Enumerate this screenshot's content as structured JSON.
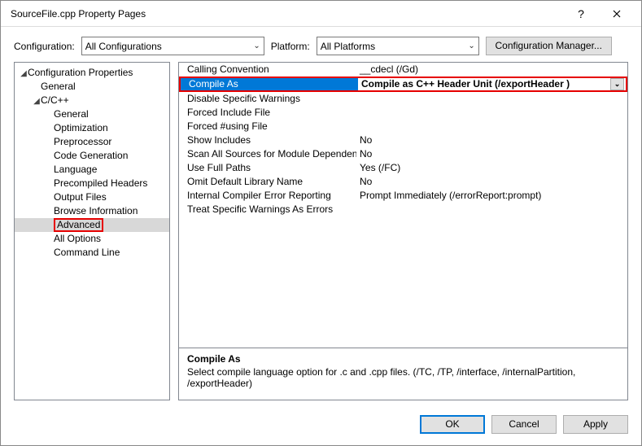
{
  "title": "SourceFile.cpp Property Pages",
  "labels": {
    "configuration": "Configuration:",
    "platform": "Platform:"
  },
  "combos": {
    "configuration": "All Configurations",
    "platform": "All Platforms"
  },
  "buttons": {
    "cfgmgr": "Configuration Manager...",
    "ok": "OK",
    "cancel": "Cancel",
    "apply": "Apply"
  },
  "tree": {
    "root": "Configuration Properties",
    "general": "General",
    "cpp": "C/C++",
    "items": [
      "General",
      "Optimization",
      "Preprocessor",
      "Code Generation",
      "Language",
      "Precompiled Headers",
      "Output Files",
      "Browse Information",
      "Advanced",
      "All Options",
      "Command Line"
    ]
  },
  "grid": [
    {
      "name": "Calling Convention",
      "value": "__cdecl (/Gd)"
    },
    {
      "name": "Compile As",
      "value": "Compile as C++ Header Unit (/exportHeader )",
      "selected": true
    },
    {
      "name": "Disable Specific Warnings",
      "value": ""
    },
    {
      "name": "Forced Include File",
      "value": ""
    },
    {
      "name": "Forced #using File",
      "value": ""
    },
    {
      "name": "Show Includes",
      "value": "No"
    },
    {
      "name": "Scan All Sources for Module Dependencies",
      "value": "No"
    },
    {
      "name": "Use Full Paths",
      "value": "Yes (/FC)"
    },
    {
      "name": "Omit Default Library Name",
      "value": "No"
    },
    {
      "name": "Internal Compiler Error Reporting",
      "value": "Prompt Immediately (/errorReport:prompt)"
    },
    {
      "name": "Treat Specific Warnings As Errors",
      "value": ""
    }
  ],
  "desc": {
    "title": "Compile As",
    "text": "Select compile language option for .c and .cpp files.     (/TC, /TP, /interface, /internalPartition, /exportHeader)"
  }
}
